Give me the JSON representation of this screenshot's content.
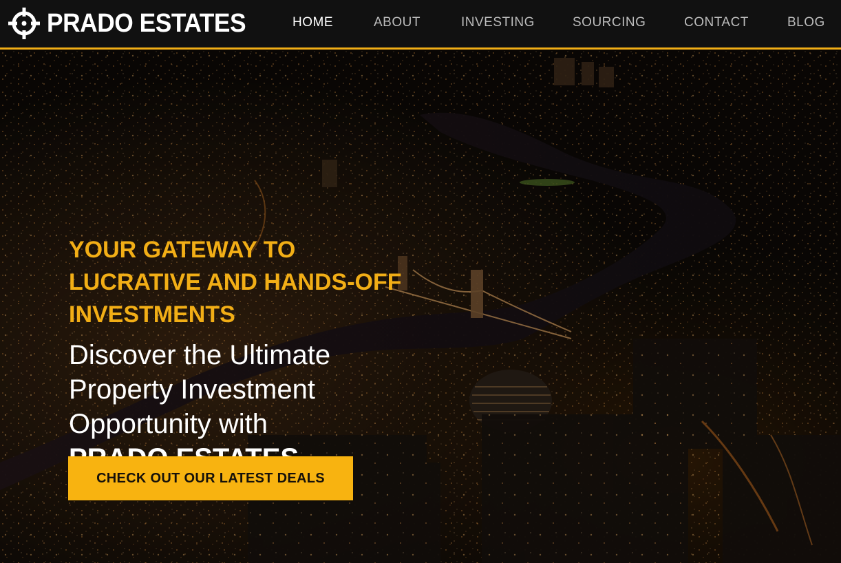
{
  "header": {
    "logo_text": "PRADO ESTATES",
    "logo_icon": "crosshair-icon",
    "nav": [
      {
        "label": "HOME",
        "active": true
      },
      {
        "label": "ABOUT",
        "active": false
      },
      {
        "label": "INVESTING",
        "active": false
      },
      {
        "label": "SOURCING",
        "active": false
      },
      {
        "label": "CONTACT",
        "active": false
      },
      {
        "label": "BLOG",
        "active": false
      }
    ]
  },
  "hero": {
    "kicker_lines": [
      "YOUR GATEWAY TO",
      "LUCRATIVE AND HANDS-OFF",
      "INVESTMENTS"
    ],
    "headline_lines": [
      "Discover the Ultimate",
      "Property Investment",
      "Opportunity with"
    ],
    "brand": "PRADO ESTATES",
    "cta_label": "CHECK OUT OUR LATEST DEALS"
  },
  "colors": {
    "accent": "#f2ae16",
    "nav_bg": "#111111",
    "nav_text": "#bdbdbd",
    "nav_active": "#ffffff"
  }
}
